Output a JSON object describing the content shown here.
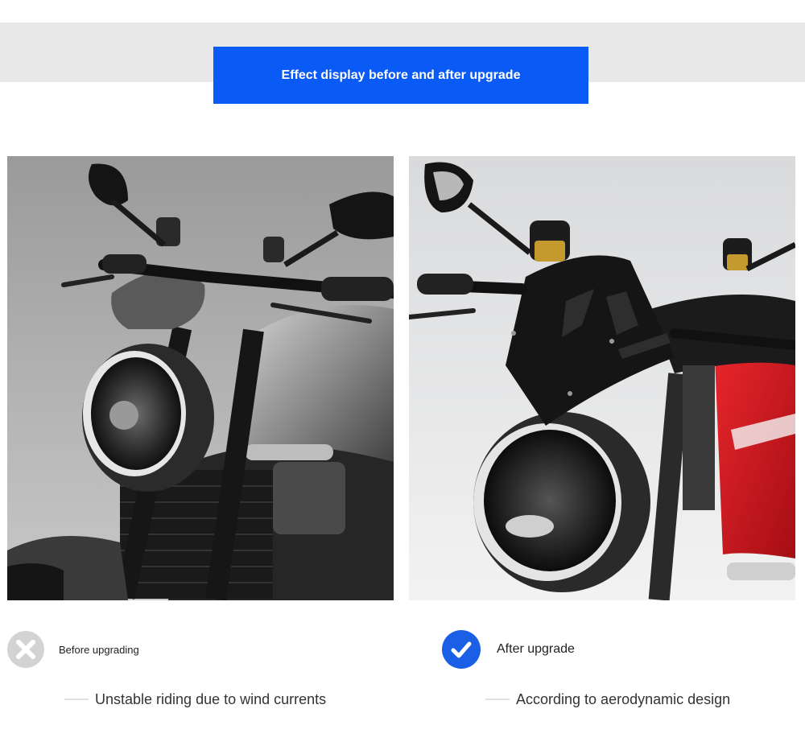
{
  "header": {
    "banner_text": "Effect display before and after upgrade",
    "banner_color": "#0a5af5"
  },
  "comparison": {
    "before": {
      "icon": "x-icon",
      "label": "Before upgrading",
      "description": "Unstable riding due to wind currents"
    },
    "after": {
      "icon": "check-icon",
      "label": "After upgrade",
      "description": "According to aerodynamic design"
    }
  }
}
